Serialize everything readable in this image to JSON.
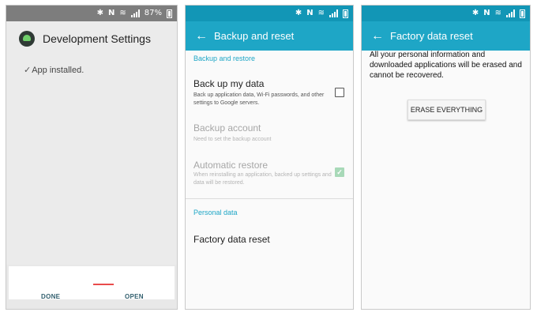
{
  "screen1": {
    "statusbar": {
      "icons": [
        "bluetooth-icon",
        "nfc-icon",
        "wifi-icon",
        "signal-icon",
        "battery-icon"
      ],
      "battery": "87%"
    },
    "header": {
      "icon": "app-icon",
      "title": "Development Settings"
    },
    "status": {
      "check": "✓",
      "text": "App installed."
    },
    "buttons": {
      "done": "DONE",
      "open": "OPEN"
    }
  },
  "screen2": {
    "statusbar": {
      "icons": [
        "bluetooth-icon",
        "nfc-icon",
        "wifi-icon",
        "signal-icon",
        "battery-icon"
      ]
    },
    "appbar": {
      "back": "←",
      "title": "Backup and reset"
    },
    "section_backup": "Backup and restore",
    "backup_data": {
      "title": "Back up my data",
      "desc": "Back up application data, Wi-Fi passwords, and other settings to Google servers.",
      "checked": false
    },
    "backup_account": {
      "title": "Backup account",
      "desc": "Need to set the backup account"
    },
    "auto_restore": {
      "title": "Automatic restore",
      "desc": "When reinstalling an application, backed up settings and data will be restored.",
      "checked": true,
      "check": "✓"
    },
    "section_personal": "Personal data",
    "factory_reset": {
      "title": "Factory data reset"
    }
  },
  "screen3": {
    "statusbar": {
      "icons": [
        "bluetooth-icon",
        "nfc-icon",
        "wifi-icon",
        "signal-icon",
        "battery-icon"
      ]
    },
    "appbar": {
      "back": "←",
      "title": "Factory data reset"
    },
    "warning": "All your personal information and downloaded applications will be erased and cannot be recovered.",
    "erase_button": "ERASE EVERYTHING"
  },
  "colors": {
    "statusbar_gray": "#7d7d7d",
    "statusbar_teal": "#1296b6",
    "appbar_teal": "#1ea6c6",
    "section_accent": "#1ea6c6",
    "checked_green": "#a8d9b8"
  }
}
